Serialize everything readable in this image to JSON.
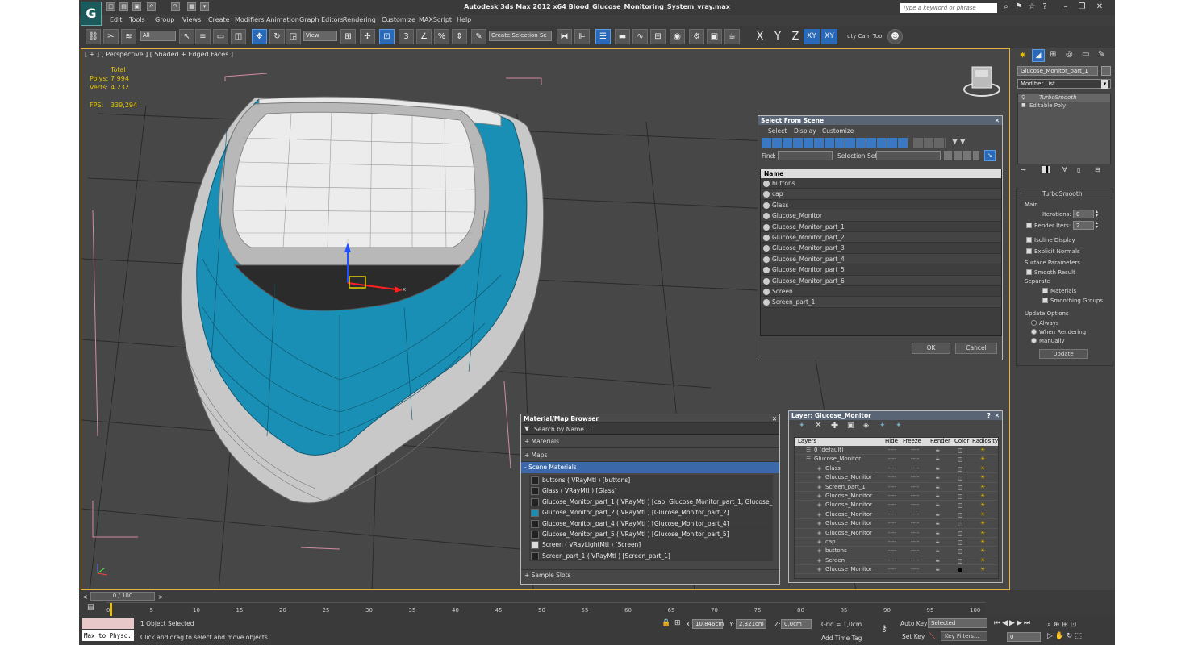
{
  "app": {
    "title": "Autodesk 3ds Max  2012 x64      Blood_Glucose_Monitoring_System_vray.max",
    "search_placeholder": "Type a keyword or phrase"
  },
  "menu": [
    "Edit",
    "Tools",
    "Group",
    "Views",
    "Create",
    "Modifiers",
    "Animation",
    "Graph Editors",
    "Rendering",
    "Customize",
    "MAXScript",
    "Help"
  ],
  "toolbar": {
    "filter": "All",
    "ref_coord": "View",
    "selection_set": "Create Selection Se",
    "axes": [
      "X",
      "Y",
      "Z",
      "XY",
      "XY"
    ],
    "cam_tool": "uty Cam Tool"
  },
  "viewport": {
    "label": "[ + ] [ Perspective ] [ Shaded + Edged Faces ]",
    "stats": {
      "total": "Total",
      "polys_label": "Polys:",
      "polys": "7 994",
      "verts_label": "Verts:",
      "verts": "4 232",
      "fps_label": "FPS:",
      "fps": "339,294"
    },
    "gizmo": {
      "x": "x",
      "z": "z"
    }
  },
  "command_panel": {
    "object_name": "Glucose_Monitor_part_1",
    "modifier_list": "Modifier List",
    "stack": [
      "TurboSmooth",
      "Editable Poly"
    ],
    "rollout_title": "TurboSmooth",
    "main": "Main",
    "iterations_label": "Iterations:",
    "iterations": "0",
    "render_iters_label": "Render Iters:",
    "render_iters": "2",
    "isoline": "Isoline Display",
    "explicit": "Explicit Normals",
    "surface_params": "Surface Parameters",
    "smooth_result": "Smooth Result",
    "separate": "Separate",
    "materials": "Materials",
    "smoothing_groups": "Smoothing Groups",
    "update_options": "Update Options",
    "always": "Always",
    "when_rendering": "When Rendering",
    "manually": "Manually",
    "update": "Update"
  },
  "select_scene": {
    "title": "Select From Scene",
    "menu": [
      "Select",
      "Display",
      "Customize"
    ],
    "find": "Find:",
    "selection_set": "Selection Set:",
    "column": "Name",
    "items": [
      "buttons",
      "cap",
      "Glass",
      "Glucose_Monitor",
      "Glucose_Monitor_part_1",
      "Glucose_Monitor_part_2",
      "Glucose_Monitor_part_3",
      "Glucose_Monitor_part_4",
      "Glucose_Monitor_part_5",
      "Glucose_Monitor_part_6",
      "Screen",
      "Screen_part_1"
    ],
    "ok": "OK",
    "cancel": "Cancel"
  },
  "material_browser": {
    "title": "Material/Map Browser",
    "search": "Search by Name ...",
    "groups": [
      "+ Materials",
      "+ Maps",
      "- Scene Materials",
      "+ Sample Slots"
    ],
    "items": [
      "buttons  ( VRayMtl ) [buttons]",
      "Glass  ( VRayMtl ) [Glass]",
      "Glucose_Monitor_part_1  ( VRayMtl ) [cap, Glucose_Monitor_part_1, Glucose_M...",
      "Glucose_Monitor_part_2  ( VRayMtl ) [Glucose_Monitor_part_2]",
      "Glucose_Monitor_part_4  ( VRayMtl ) [Glucose_Monitor_part_4]",
      "Glucose_Monitor_part_5  ( VRayMtl ) [Glucose_Monitor_part_5]",
      "Screen  ( VRayLightMtl ) [Screen]",
      "Screen_part_1  ( VRayMtl ) [Screen_part_1]"
    ]
  },
  "layer_manager": {
    "title": "Layer: Glucose_Monitor",
    "columns": [
      "Layers",
      "Hide",
      "Freeze",
      "Render",
      "Color",
      "Radiosity"
    ],
    "layers": [
      "0 (default)",
      "Glucose_Monitor"
    ],
    "children": [
      "Glass",
      "Glucose_Monitor",
      "Screen_part_1",
      "Glucose_Monitor",
      "Glucose_Monitor",
      "Glucose_Monitor",
      "Glucose_Monitor",
      "Glucose_Monitor",
      "cap",
      "buttons",
      "Screen",
      "Glucose_Monitor"
    ]
  },
  "timeline": {
    "frame": "0 / 100",
    "ticks": [
      "0",
      "5",
      "10",
      "15",
      "20",
      "25",
      "30",
      "35",
      "40",
      "45",
      "50",
      "55",
      "60",
      "65",
      "70",
      "75",
      "80",
      "85",
      "90",
      "95",
      "100"
    ]
  },
  "status": {
    "script": "Max to Physc.",
    "selected": "1 Object Selected",
    "hint": "Click and drag to select and move objects",
    "x_label": "X:",
    "x": "10,846cm",
    "y_label": "Y:",
    "y": "2,321cm",
    "z_label": "Z:",
    "z": "0,0cm",
    "grid": "Grid = 1,0cm",
    "add_time_tag": "Add Time Tag",
    "auto_key": "Auto Key",
    "set_key": "Set Key",
    "key_mode": "Selected",
    "key_filters": "Key Filters...",
    "frame_field": "0"
  },
  "colors": {
    "accent": "#2a68b8",
    "model_cyan": "#1a8fb5",
    "viewport": "#474747"
  }
}
